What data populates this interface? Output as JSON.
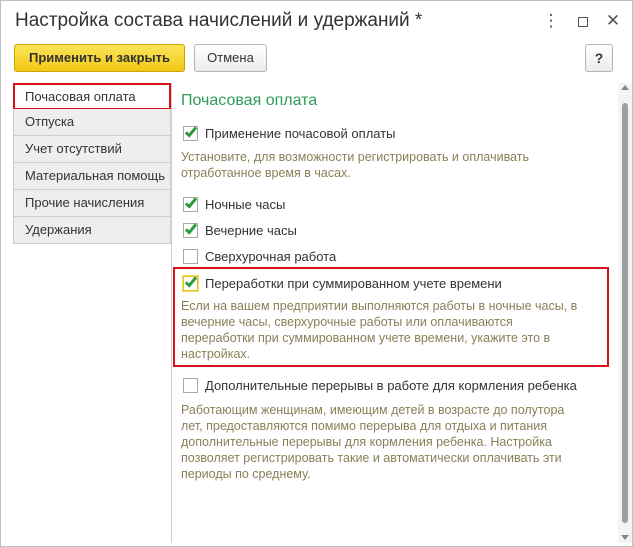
{
  "window": {
    "title": "Настройка состава начислений и удержаний *",
    "menu_icon": "more-vertical-icon",
    "maximize_icon": "maximize-icon",
    "close_icon": "close-icon"
  },
  "toolbar": {
    "apply_label": "Применить и закрыть",
    "cancel_label": "Отмена",
    "help_label": "?"
  },
  "sidebar": {
    "items": [
      {
        "label": "Почасовая оплата",
        "active": true
      },
      {
        "label": "Отпуска"
      },
      {
        "label": "Учет отсутствий"
      },
      {
        "label": "Материальная помощь"
      },
      {
        "label": "Прочие начисления"
      },
      {
        "label": "Удержания"
      }
    ]
  },
  "content": {
    "title": "Почасовая оплата",
    "options": [
      {
        "label": "Применение почасовой оплаты",
        "checked": true
      },
      {
        "label": "Ночные часы",
        "checked": true
      },
      {
        "label": "Вечерние часы",
        "checked": true
      },
      {
        "label": "Сверхурочная работа",
        "checked": false
      },
      {
        "label": "Переработки при суммированном учете времени",
        "checked": true
      },
      {
        "label": "Дополнительные перерывы в работе для кормления ребенка",
        "checked": false
      }
    ],
    "hints": {
      "hourly_1": "Установите, для возможности регистрировать и оплачивать",
      "hourly_2": "отработанное время в часах.",
      "overtime_1": "Если на вашем предприятии выполняются работы в ночные часы, в",
      "overtime_2": "вечерние часы, сверхурочные работы или оплачиваются",
      "overtime_3": "переработки при суммированном учете времени, укажите это в",
      "overtime_4": "настройках.",
      "breaks_1": "Работающим женщинам, имеющим детей в возрасте до полутора",
      "breaks_2": "лет, предоставляются помимо перерыва для отдыха и питания",
      "breaks_3": "дополнительные перерывы для кормления ребенка. Настройка",
      "breaks_4": "позволяет регистрировать такие и автоматически оплачивать эти",
      "breaks_5": "периоды по среднему."
    }
  },
  "colors": {
    "accent_yellow": "#f2c814",
    "section_green": "#2e9c57",
    "highlight_red": "#d8121b",
    "hint_text": "#8a7f58"
  }
}
